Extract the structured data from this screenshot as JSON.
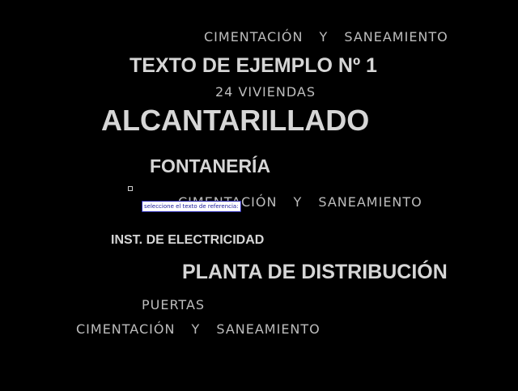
{
  "canvas": {
    "background": "#000000",
    "texts": [
      "CIMENTACIÓN Y SANEAMIENTO",
      "TEXTO DE EJEMPLO Nº 1",
      "24 VIVIENDAS",
      "ALCANTARILLADO",
      "FONTANERÍA",
      "CIMENTACIÓN Y SANEAMIENTO",
      "INST. DE ELECTRICIDAD",
      "PLANTA DE DISTRIBUCIÓN",
      "PUERTAS",
      "CIMENTACIÓN Y SANEAMIENTO"
    ]
  },
  "cursor": {
    "icon": "pickbox-cursor-icon"
  },
  "tooltip": {
    "text": "seleccione el texto de referencia:"
  }
}
